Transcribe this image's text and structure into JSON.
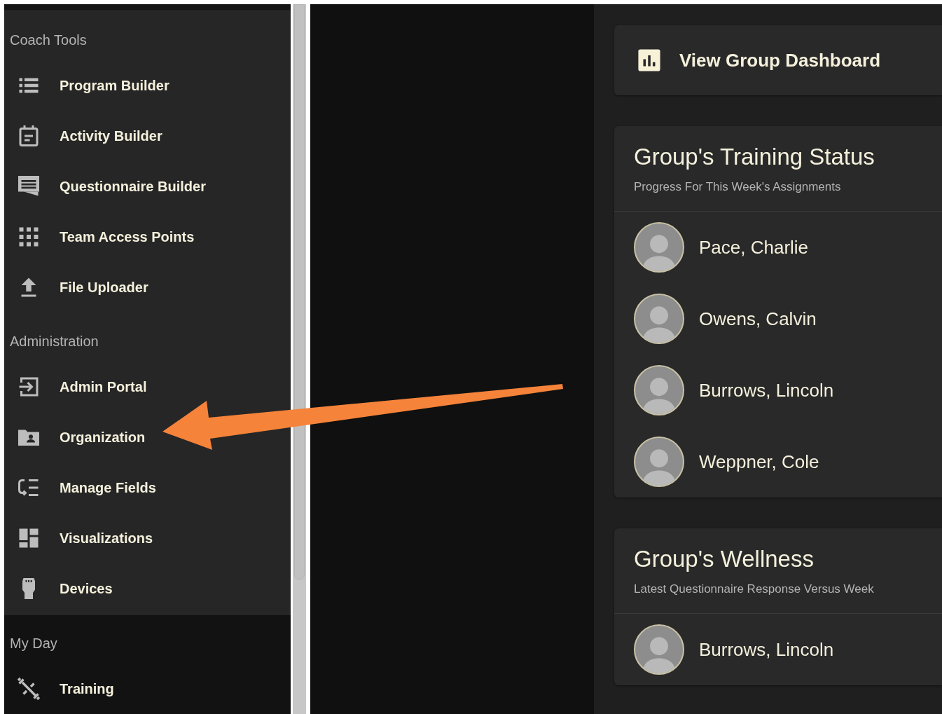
{
  "sidebar": {
    "sections": [
      {
        "title": "Coach Tools",
        "items": [
          {
            "label": "Program Builder"
          },
          {
            "label": "Activity Builder"
          },
          {
            "label": "Questionnaire Builder"
          },
          {
            "label": "Team Access Points"
          },
          {
            "label": "File Uploader"
          }
        ]
      },
      {
        "title": "Administration",
        "items": [
          {
            "label": "Admin Portal"
          },
          {
            "label": "Organization"
          },
          {
            "label": "Manage Fields"
          },
          {
            "label": "Visualizations"
          },
          {
            "label": "Devices"
          }
        ]
      },
      {
        "title": "My Day",
        "items": [
          {
            "label": "Training"
          }
        ]
      }
    ]
  },
  "dashboard_link": {
    "label": "View Group Dashboard"
  },
  "cards": [
    {
      "title": "Group's Training Status",
      "subtitle": "Progress For This Week's Assignments",
      "athletes": [
        {
          "name": "Pace, Charlie"
        },
        {
          "name": "Owens, Calvin"
        },
        {
          "name": "Burrows, Lincoln"
        },
        {
          "name": "Weppner, Cole"
        }
      ]
    },
    {
      "title": "Group's Wellness",
      "subtitle": "Latest Questionnaire Response Versus Week",
      "athletes": [
        {
          "name": "Burrows, Lincoln"
        }
      ]
    }
  ],
  "annotation": {
    "kind": "arrow"
  }
}
